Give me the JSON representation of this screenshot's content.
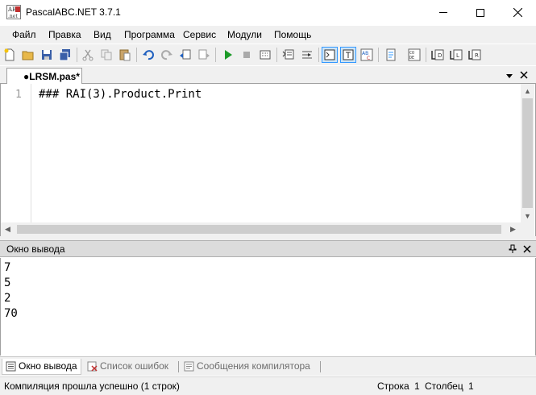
{
  "window": {
    "title": "PascalABC.NET 3.7.1"
  },
  "menu": [
    "Файл",
    "Правка",
    "Вид",
    "Программа",
    "Сервис",
    "Модули",
    "Помощь"
  ],
  "editor": {
    "tab_label": "●LRSM.pas*",
    "line_number": "1",
    "code": "### RAI(3).Product.Print"
  },
  "output": {
    "title": "Окно вывода",
    "lines": [
      "7",
      "5",
      "2",
      "70"
    ]
  },
  "bottom_tabs": [
    {
      "label": "Окно вывода",
      "icon": "output-window-icon"
    },
    {
      "label": "Список ошибок",
      "icon": "error-list-icon"
    },
    {
      "label": "Сообщения компилятора",
      "icon": "compiler-messages-icon"
    }
  ],
  "status": {
    "message": "Компиляция прошла успешно (1 строк)",
    "row_label": "Строка",
    "row_value": "1",
    "col_label": "Столбец",
    "col_value": "1"
  },
  "app_icon_text": "ABC.NET",
  "colors": {
    "accent": "#3399ff",
    "run": "#1c9a27",
    "undo": "#1f5fbf"
  }
}
